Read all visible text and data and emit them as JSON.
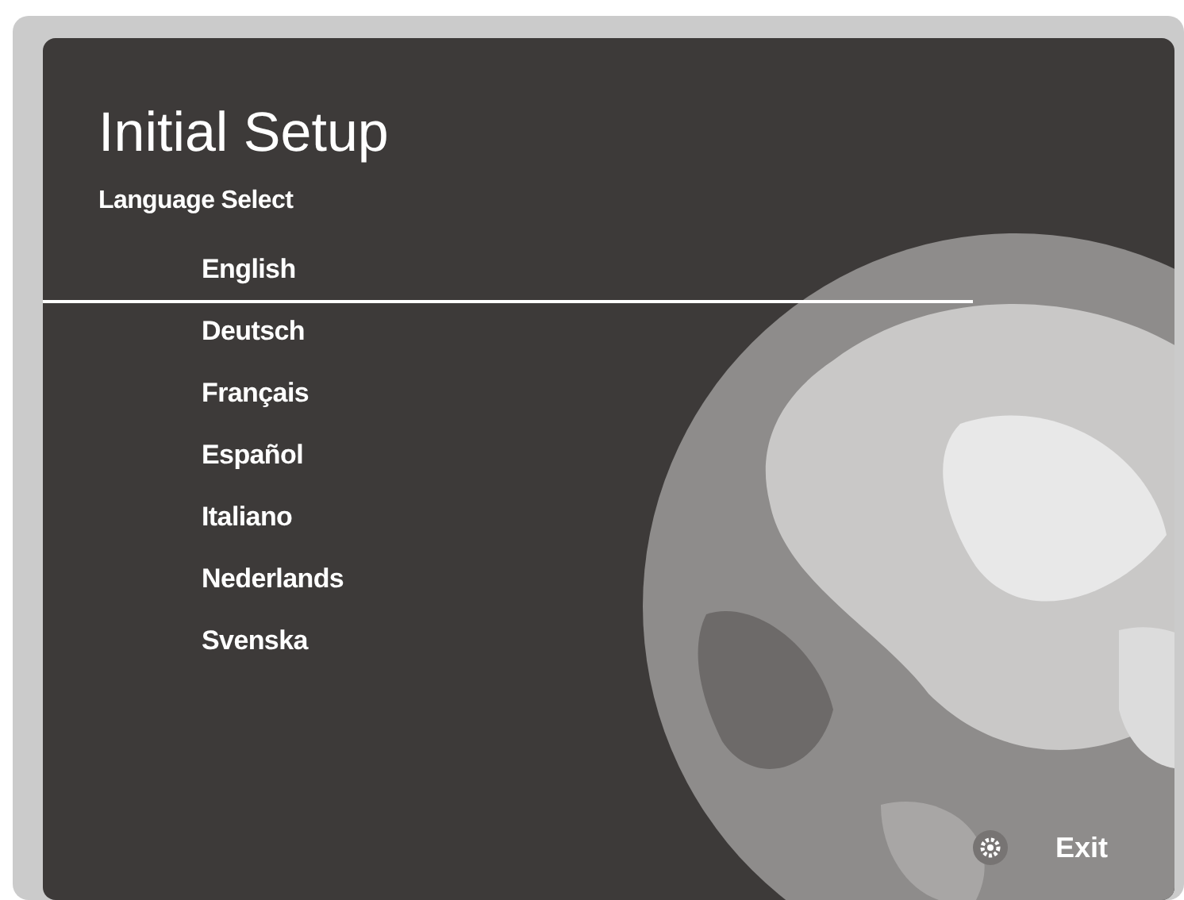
{
  "screen": {
    "title": "Initial Setup",
    "subtitle": "Language Select"
  },
  "languages": [
    {
      "label": "English",
      "selected": true
    },
    {
      "label": "Deutsch",
      "selected": false
    },
    {
      "label": "Français",
      "selected": false
    },
    {
      "label": "Español",
      "selected": false
    },
    {
      "label": "Italiano",
      "selected": false
    },
    {
      "label": "Nederlands",
      "selected": false
    },
    {
      "label": "Svenska",
      "selected": false
    }
  ],
  "exit": {
    "label": "Exit"
  }
}
